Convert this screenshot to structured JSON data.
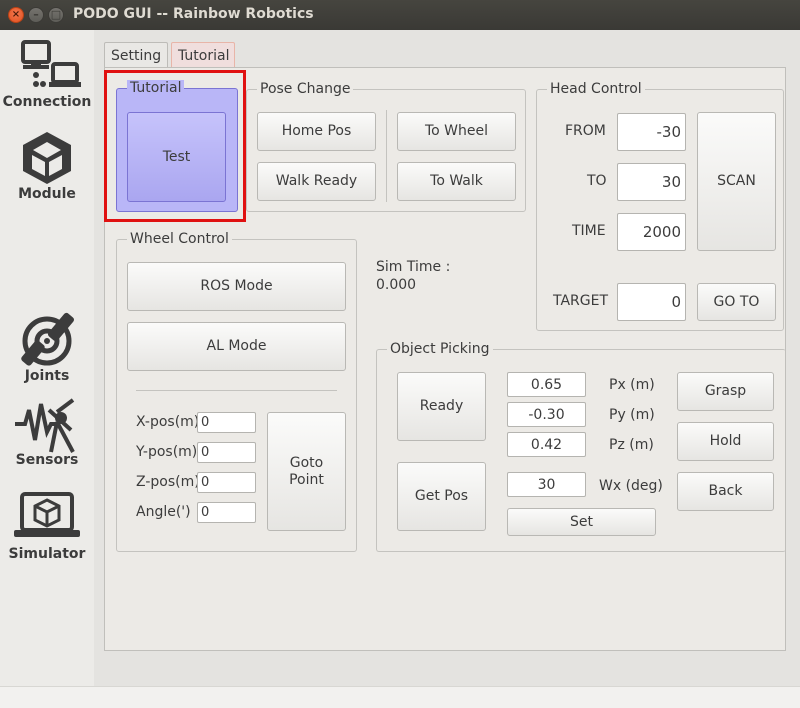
{
  "window": {
    "title": "PODO GUI -- Rainbow Robotics",
    "controls": {
      "close": "×",
      "minimize": "–",
      "maximize": "□"
    }
  },
  "sidebar": {
    "items": [
      {
        "label": "Connection",
        "icon": "connection-icon"
      },
      {
        "label": "Module",
        "icon": "module-icon"
      },
      {
        "label": "Joints",
        "icon": "joints-icon"
      },
      {
        "label": "Sensors",
        "icon": "sensors-icon"
      },
      {
        "label": "Simulator",
        "icon": "simulator-icon"
      }
    ]
  },
  "tabs": [
    {
      "label": "Setting",
      "active": false
    },
    {
      "label": "Tutorial",
      "active": true
    }
  ],
  "tutorial": {
    "title": "Tutorial",
    "test_label": "Test"
  },
  "pose_change": {
    "title": "Pose Change",
    "home_pos": "Home Pos",
    "walk_ready": "Walk Ready",
    "to_wheel": "To Wheel",
    "to_walk": "To Walk"
  },
  "head_control": {
    "title": "Head Control",
    "from_label": "FROM",
    "from_value": "-30",
    "to_label": "TO",
    "to_value": "30",
    "time_label": "TIME",
    "time_value": "2000",
    "scan_label": "SCAN",
    "target_label": "TARGET",
    "target_value": "0",
    "goto_label": "GO TO"
  },
  "sim_time": {
    "label": "Sim Time :",
    "value": "0.000"
  },
  "wheel_control": {
    "title": "Wheel Control",
    "ros_mode": "ROS Mode",
    "al_mode": "AL Mode",
    "x_label": "X-pos(m)",
    "x_value": "0",
    "y_label": "Y-pos(m)",
    "y_value": "0",
    "z_label": "Z-pos(m)",
    "z_value": "0",
    "angle_label": "Angle(')",
    "angle_value": "0",
    "goto_point": "Goto\nPoint"
  },
  "object_picking": {
    "title": "Object Picking",
    "ready": "Ready",
    "get_pos": "Get Pos",
    "px_value": "0.65",
    "px_label": "Px (m)",
    "py_value": "-0.30",
    "py_label": "Py (m)",
    "pz_value": "0.42",
    "pz_label": "Pz (m)",
    "wx_value": "30",
    "wx_label": "Wx (deg)",
    "set": "Set",
    "grasp": "Grasp",
    "hold": "Hold",
    "back": "Back"
  },
  "colors": {
    "highlight": "#e01111",
    "tutorial_fill": "#b9b6f7",
    "active_tab": "#f0dedd",
    "close_button": "#e95420"
  }
}
